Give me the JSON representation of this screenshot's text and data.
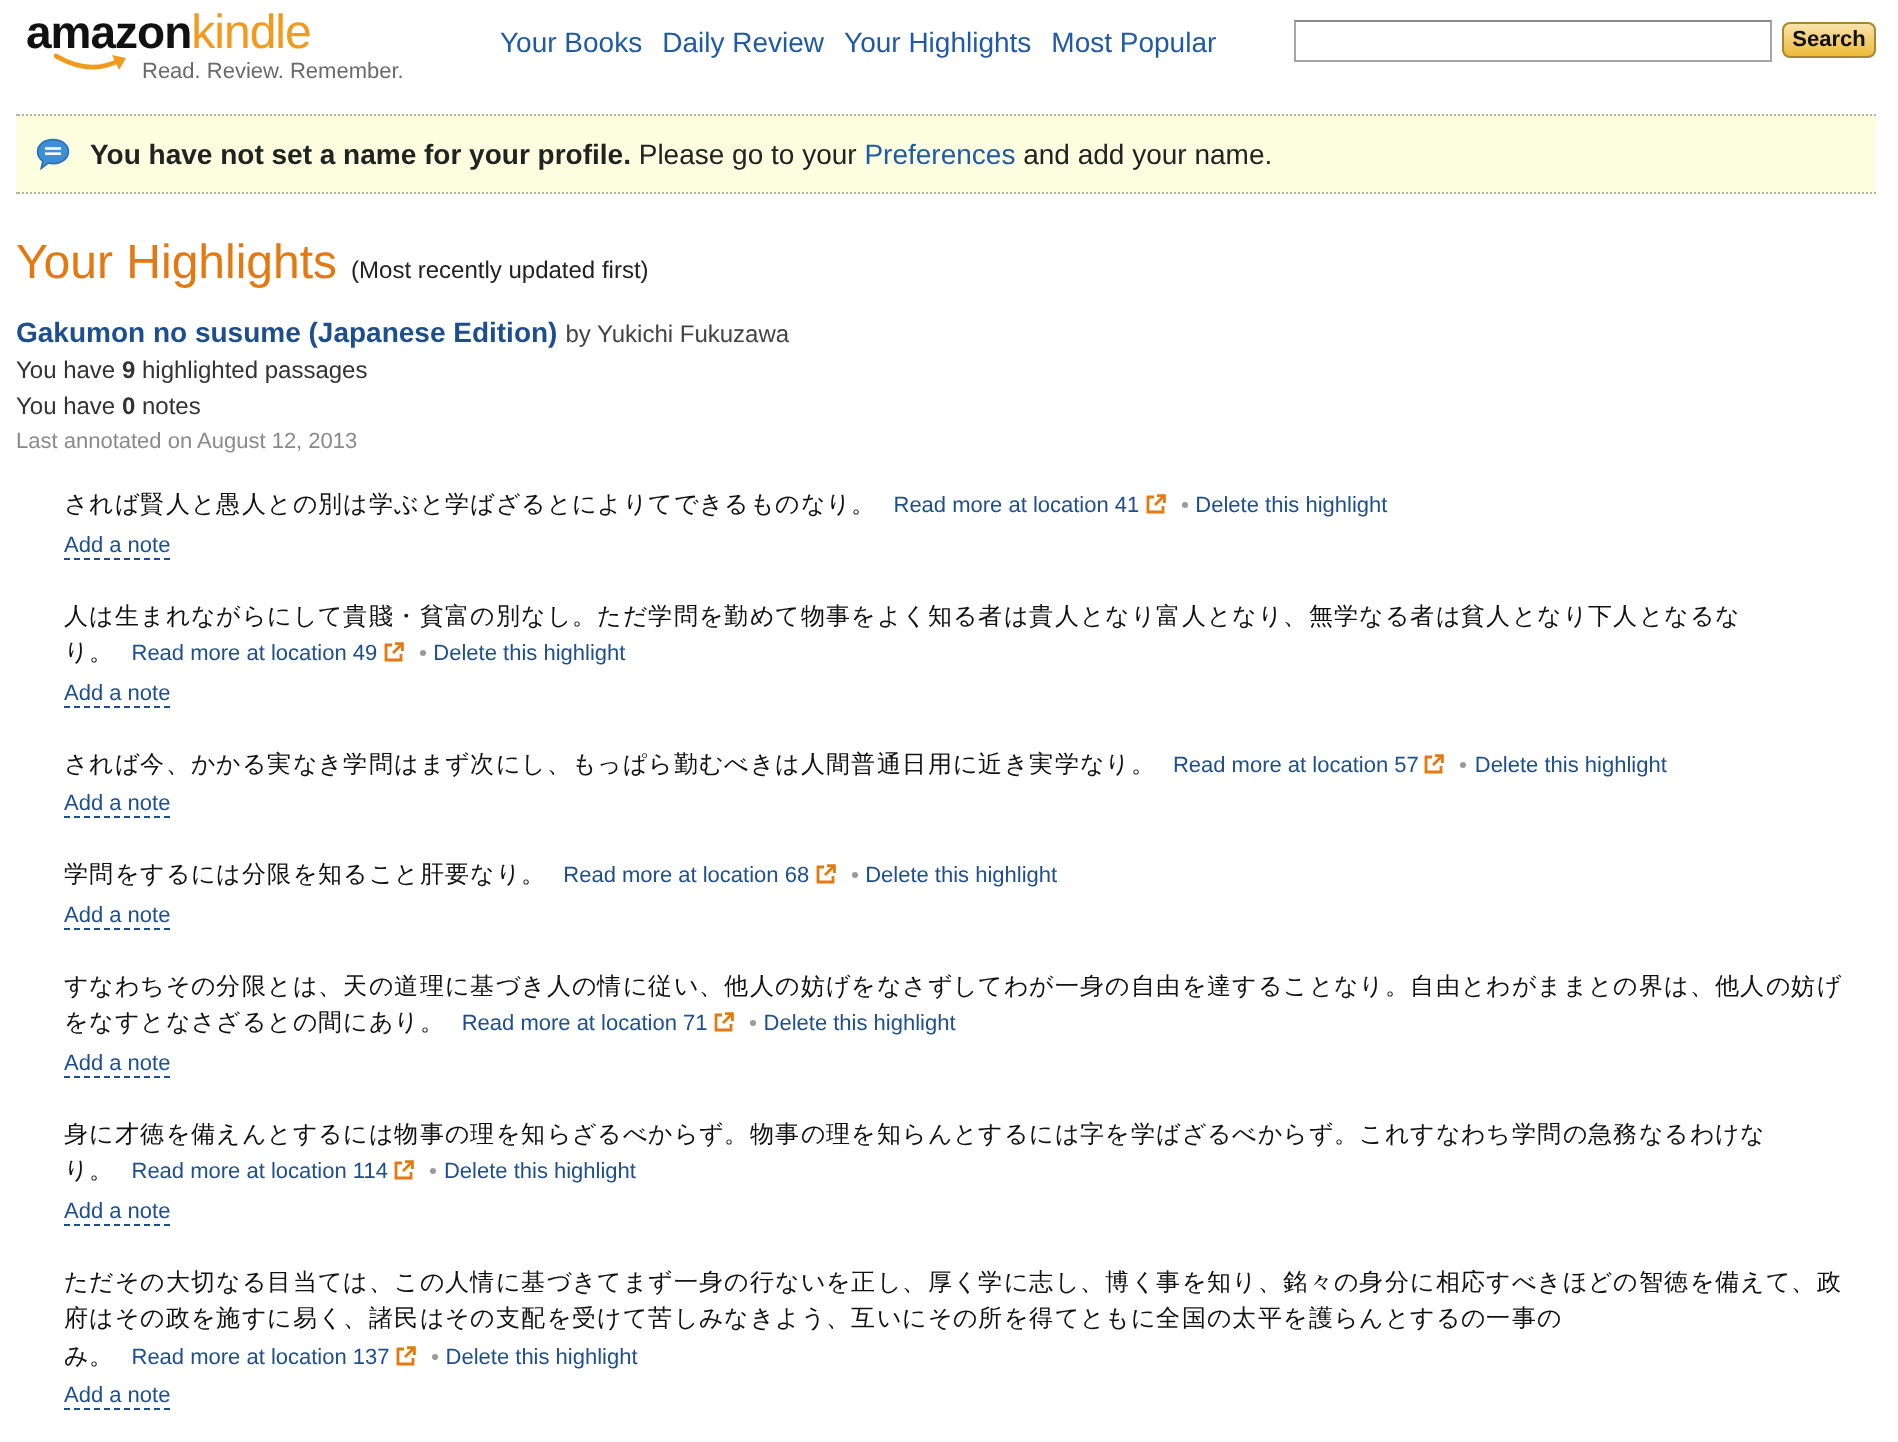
{
  "header": {
    "logo": {
      "brand": "amazon",
      "product": "kindle",
      "tagline": "Read. Review. Remember."
    },
    "nav": [
      "Your Books",
      "Daily Review",
      "Your Highlights",
      "Most Popular"
    ],
    "search": {
      "button": "Search"
    }
  },
  "notice": {
    "message": "**You have not set a name for your profile.** Please go to your",
    "link": "Preferences",
    "message_end": "and add your name."
  },
  "page": {
    "title": "Your Highlights",
    "subtitle": "(Most recently updated first)"
  },
  "book": {
    "title": "Gakumon no susume (Japanese Edition)",
    "author": "by Yukichi Fukuzawa",
    "highlight_count": "You have **9** highlighted passages",
    "note_count": "You have **0** notes",
    "last_annotated": "Last annotated on August 12, 2013"
  },
  "highlights": [
    {
      "text": "されば賢人と愚人との別は学ぶと学ばざるとによりてできるものなり。",
      "read_more": "Read more at location 41",
      "delete": "Delete this highlight",
      "add_note": "Add a note"
    },
    {
      "text": "人は生まれながらにして貴賤・貧富の別なし。ただ学問を勤めて物事をよく知る者は貴人となり富人となり、無学なる者は貧人となり下人となるなり。",
      "read_more": "Read more at location 49",
      "delete": "Delete this highlight",
      "add_note": "Add a note"
    },
    {
      "text": "されば今、かかる実なき学問はまず次にし、もっぱら勤むべきは人間普通日用に近き実学なり。",
      "read_more": "Read more at location 57",
      "delete": "Delete this highlight",
      "add_note": "Add a note"
    },
    {
      "text": "学問をするには分限を知ること肝要なり。",
      "read_more": "Read more at location 68",
      "delete": "Delete this highlight",
      "add_note": "Add a note"
    },
    {
      "text": "すなわちその分限とは、天の道理に基づき人の情に従い、他人の妨げをなさずしてわが一身の自由を達することなり。自由とわがままとの界は、他人の妨げをなすとなさざるとの間にあり。",
      "read_more": "Read more at location 71",
      "delete": "Delete this highlight",
      "add_note": "Add a note"
    },
    {
      "text": "身に才徳を備えんとするには物事の理を知らざるべからず。物事の理を知らんとするには字を学ばざるべからず。これすなわち学問の急務なるわけなり。",
      "read_more": "Read more at location 114",
      "delete": "Delete this highlight",
      "add_note": "Add a note"
    },
    {
      "text": "ただその大切なる目当ては、この人情に基づきてまず一身の行ないを正し、厚く学に志し、博く事を知り、銘々の身分に相応すべきほどの智徳を備えて、政府はその政を施すに易く、諸民はその支配を受けて苦しみなきよう、互いにその所を得てともに全国の太平を護らんとするの一事のみ。",
      "read_more": "Read more at location 137",
      "delete": "Delete this highlight",
      "add_note": "Add a note"
    }
  ]
}
